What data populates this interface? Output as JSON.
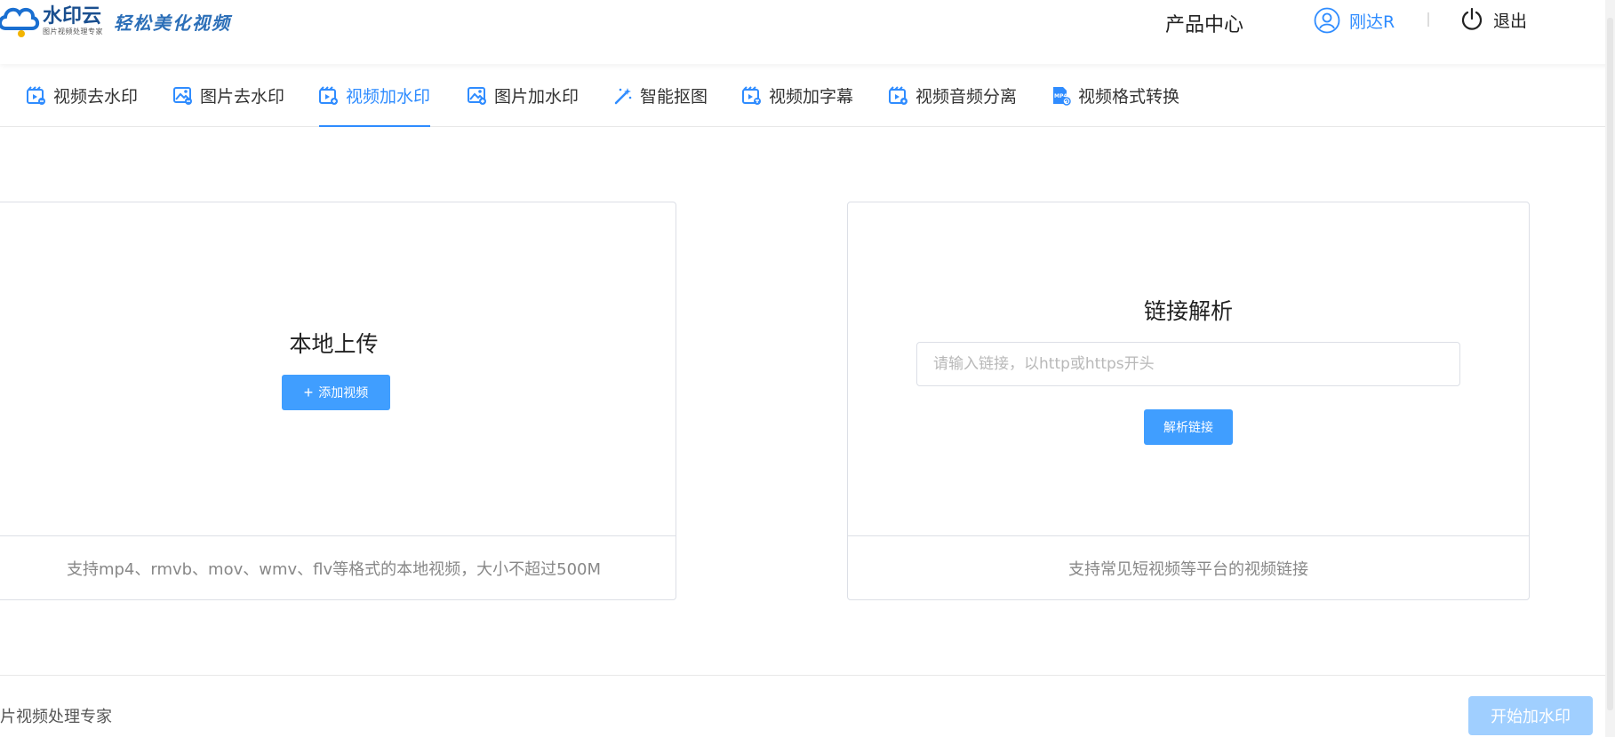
{
  "header": {
    "brand_name": "水印云",
    "brand_sub": "图片视频处理专家",
    "slogan": "轻松美化视频",
    "product_center": "产品中心",
    "username": "刚达R",
    "logout": "退出"
  },
  "tabs": [
    {
      "label": "视频去水印",
      "icon": "video-remove-watermark-icon",
      "active": false
    },
    {
      "label": "图片去水印",
      "icon": "image-remove-watermark-icon",
      "active": false
    },
    {
      "label": "视频加水印",
      "icon": "video-add-watermark-icon",
      "active": true
    },
    {
      "label": "图片加水印",
      "icon": "image-add-watermark-icon",
      "active": false
    },
    {
      "label": "智能抠图",
      "icon": "magic-wand-icon",
      "active": false
    },
    {
      "label": "视频加字幕",
      "icon": "video-subtitle-icon",
      "active": false
    },
    {
      "label": "视频音频分离",
      "icon": "video-audio-split-icon",
      "active": false
    },
    {
      "label": "视频格式转换",
      "icon": "mp4-convert-icon",
      "active": false
    }
  ],
  "local_upload": {
    "title": "本地上传",
    "button": "添加视频",
    "hint": "支持mp4、rmvb、mov、wmv、flv等格式的本地视频，大小不超过500M"
  },
  "link_parse": {
    "title": "链接解析",
    "input_value": "",
    "input_placeholder": "请输入链接，以http或https开头",
    "button": "解析链接",
    "hint": "支持常见短视频等平台的视频链接"
  },
  "bottom": {
    "text": "片视频处理专家",
    "start_button": "开始加水印"
  },
  "colors": {
    "accent": "#2f8cff",
    "button_primary": "#409eff",
    "button_disabled": "#a0cfff",
    "brand_dark": "#1a4f8f"
  }
}
